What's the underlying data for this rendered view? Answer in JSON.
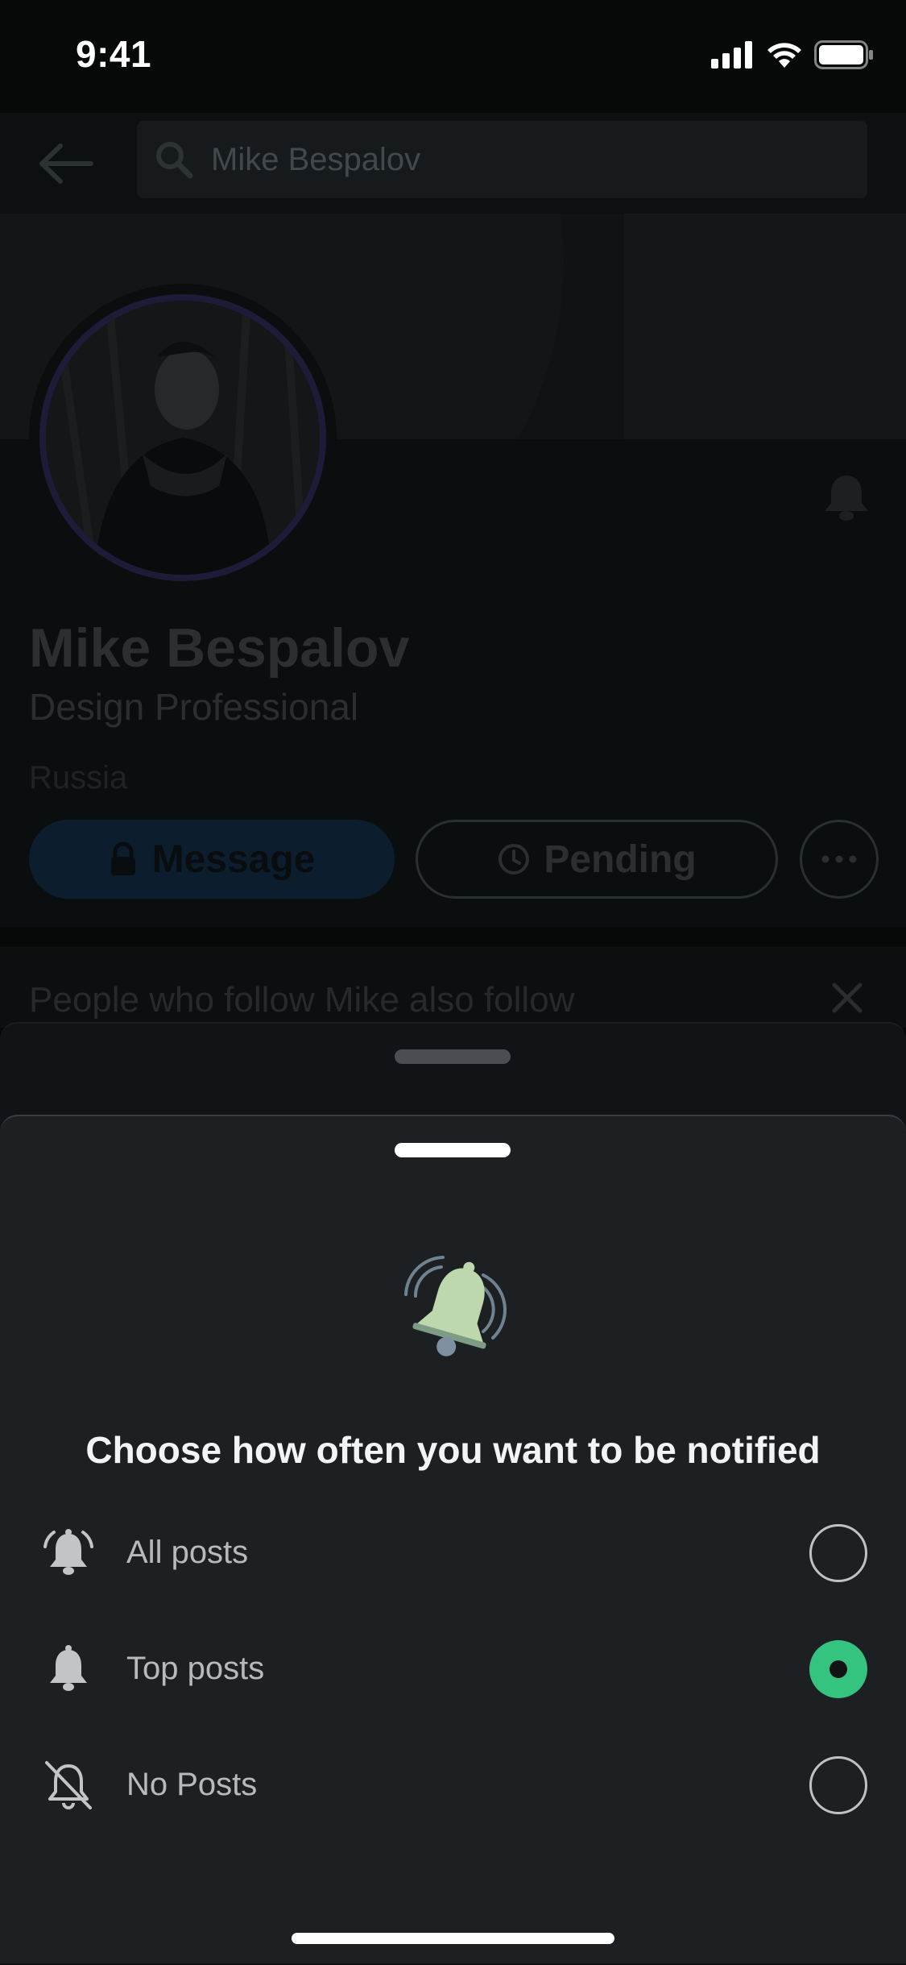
{
  "status_bar": {
    "time": "9:41"
  },
  "search": {
    "value": "Mike Bespalov"
  },
  "profile": {
    "name": "Mike Bespalov",
    "headline": "Design Professional",
    "location": "Russia",
    "message_label": "Message",
    "pending_label": "Pending"
  },
  "suggestions": {
    "title": "People who follow Mike also follow"
  },
  "sheet": {
    "title": "Choose how often you want to be notified",
    "options": [
      {
        "label": "All posts",
        "selected": false
      },
      {
        "label": "Top posts",
        "selected": true
      },
      {
        "label": "No Posts",
        "selected": false
      }
    ]
  },
  "colors": {
    "accent_selected": "#35c47f",
    "sheet_background": "#1d2023",
    "bell_illustration": "#bed8ad"
  }
}
